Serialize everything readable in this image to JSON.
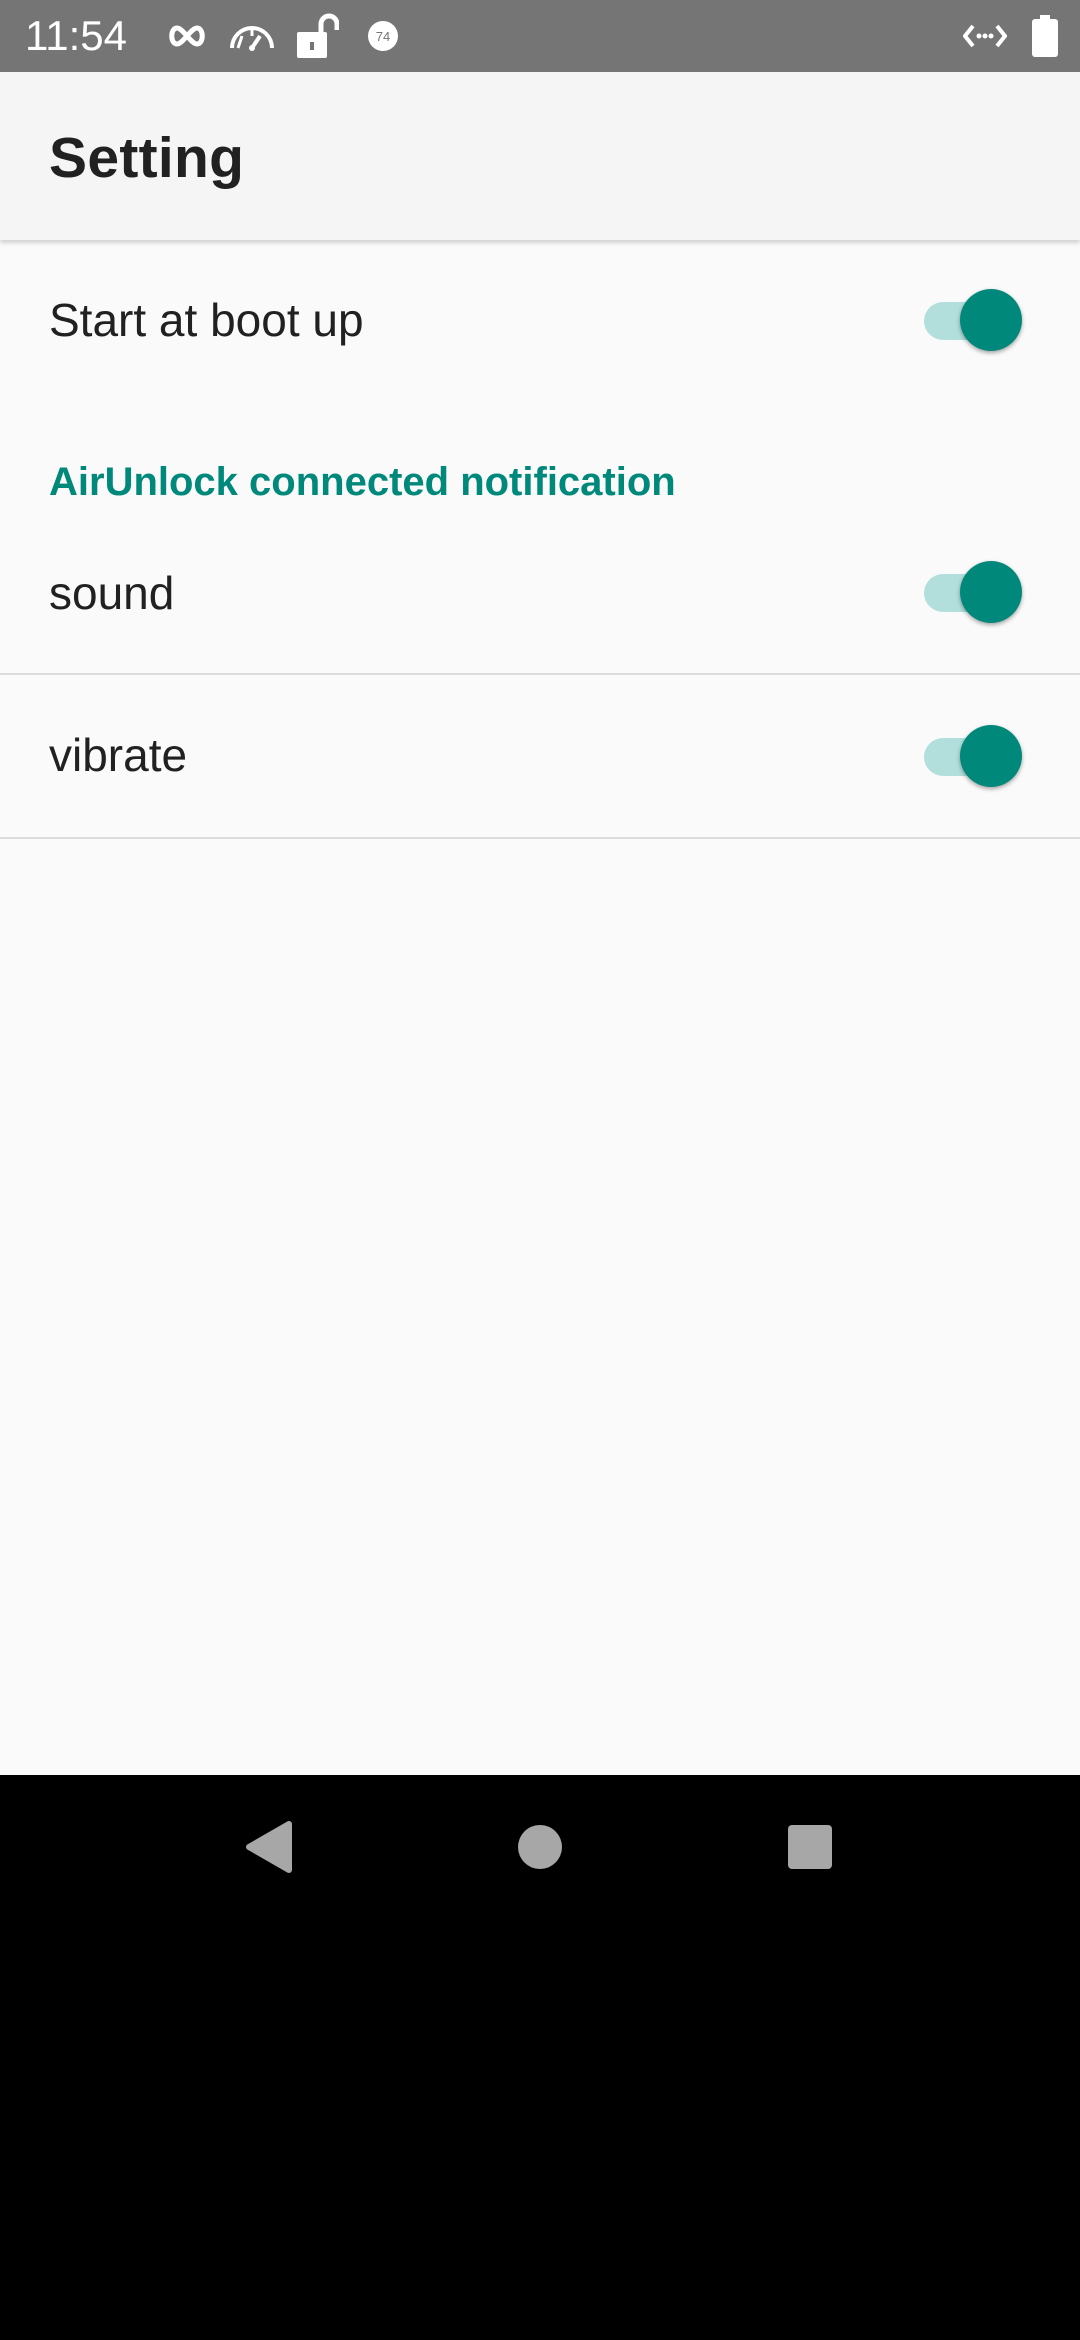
{
  "status_bar": {
    "time": "11:54",
    "icons": [
      "infinity-icon",
      "speedometer-icon",
      "unlocked-padlock-icon",
      "badge-74-icon",
      "code-arrows-icon",
      "battery-icon"
    ],
    "badge_number": "74",
    "background": "#757575"
  },
  "app_bar": {
    "title": "Setting"
  },
  "preferences": {
    "start_at_boot": {
      "label": "Start at boot up",
      "enabled": true
    },
    "category": {
      "title": "AirUnlock connected notification"
    },
    "sound": {
      "label": "sound",
      "enabled": true
    },
    "vibrate": {
      "label": "vibrate",
      "enabled": true
    }
  },
  "nav_bar": {
    "icons": [
      "back-icon",
      "home-icon",
      "recents-icon"
    ]
  },
  "colors": {
    "accent": "#00897b",
    "switch_track": "#b2dfdb",
    "app_bar": "#f5f5f5",
    "content_bg": "#fafafa"
  }
}
